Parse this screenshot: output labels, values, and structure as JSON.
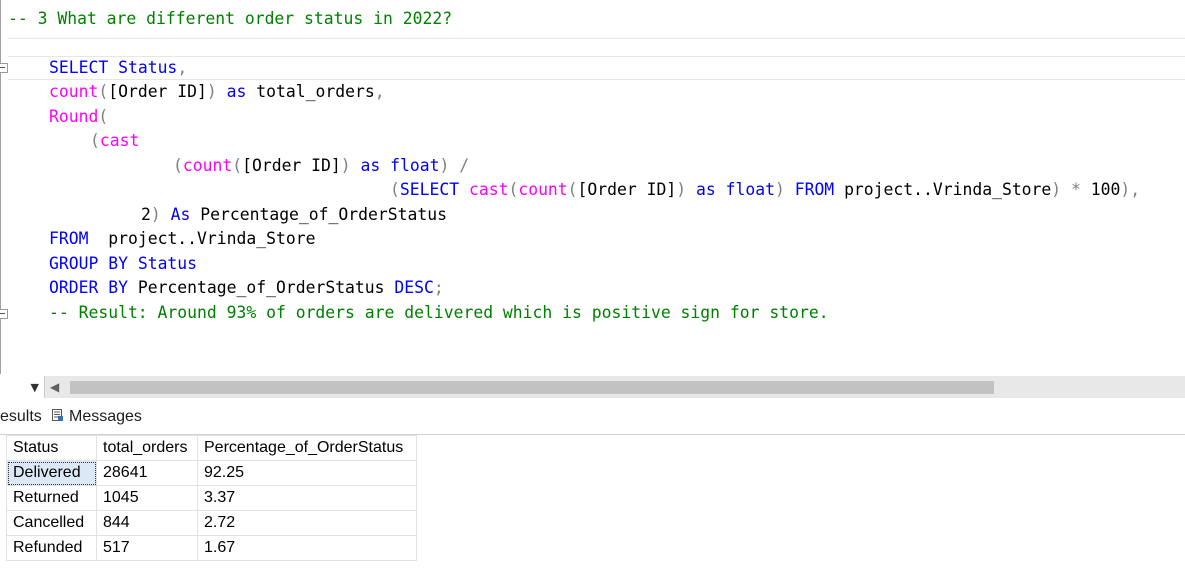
{
  "editor": {
    "comment_question": "-- 3 What are different order status in 2022?",
    "line1": {
      "select": "SELECT",
      "col": "Status",
      "comma": ","
    },
    "line2": {
      "fn": "count",
      "open": "(",
      "arg": "[Order ID]",
      "close": ")",
      "as": "as",
      "alias": "total_orders",
      "comma": ","
    },
    "line3": {
      "fn": "Round",
      "open": "("
    },
    "line4": {
      "open": "(",
      "fn": "cast"
    },
    "line5": {
      "open": "(",
      "fn": "count",
      "open2": "(",
      "arg": "[Order ID]",
      "close2": ")",
      "as": "as",
      "type": "float",
      "close": ")",
      "op": "/"
    },
    "line6": {
      "open": "(",
      "select": "SELECT",
      "fn1": "cast",
      "open1": "(",
      "fn2": "count",
      "open2": "(",
      "arg": "[Order ID]",
      "close2": ")",
      "as": "as",
      "type": "float",
      "close1": ")",
      "from": "FROM",
      "table": "project..Vrinda_Store",
      "close": ")",
      "op": "*",
      "num": "100",
      "close3": "),",
      "tail": ","
    },
    "line7": {
      "digits": "2",
      "close": ")",
      "as": "As",
      "alias": "Percentage_of_OrderStatus"
    },
    "line8": {
      "from": "FROM",
      "table": "project..Vrinda_Store"
    },
    "line9": {
      "group": "GROUP BY",
      "col": "Status"
    },
    "line10": {
      "order": "ORDER BY",
      "col": "Percentage_of_OrderStatus",
      "desc": "DESC",
      "semi": ";"
    },
    "comment_result": "-- Result: Around 93% of orders are delivered which is positive sign for store."
  },
  "results_tabs": {
    "results_label": "esults",
    "messages_label": "Messages"
  },
  "grid": {
    "columns": [
      "Status",
      "total_orders",
      "Percentage_of_OrderStatus"
    ],
    "rows": [
      [
        "Delivered",
        "28641",
        "92.25"
      ],
      [
        "Returned",
        "1045",
        "3.37"
      ],
      [
        "Cancelled",
        "844",
        "2.72"
      ],
      [
        "Refunded",
        "517",
        "1.67"
      ]
    ]
  },
  "icons": {
    "fold": "collapse-box-icon",
    "zoom": "chevron-down-icon",
    "scroll": "scroll-left-arrow-icon",
    "messages": "messages-icon"
  },
  "colors": {
    "keyword": "#0000ff",
    "function": "#ff00ff",
    "operator": "#808080",
    "comment": "#008000",
    "selection": "#dde8f6"
  }
}
